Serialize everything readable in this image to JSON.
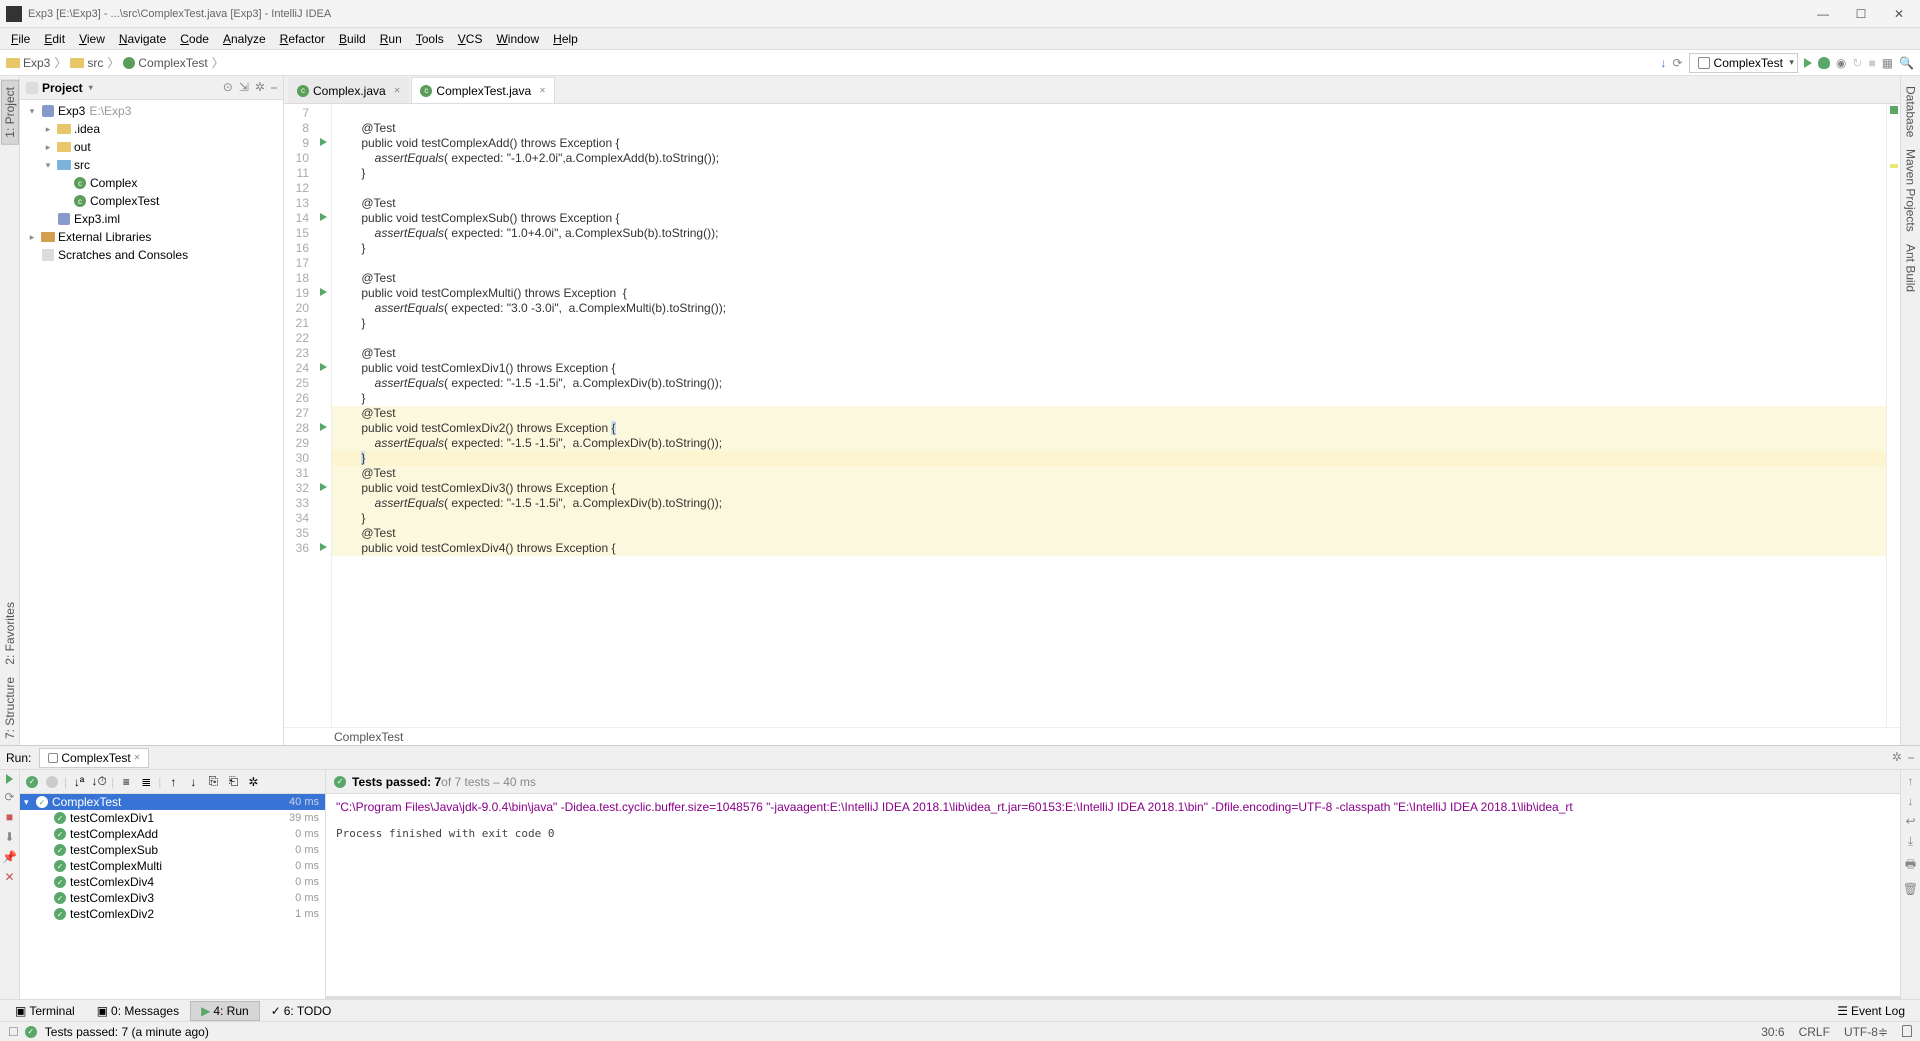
{
  "title": "Exp3 [E:\\Exp3] - ...\\src\\ComplexTest.java [Exp3] - IntelliJ IDEA",
  "menu": [
    "File",
    "Edit",
    "View",
    "Navigate",
    "Code",
    "Analyze",
    "Refactor",
    "Build",
    "Run",
    "Tools",
    "VCS",
    "Window",
    "Help"
  ],
  "breadcrumbs": [
    {
      "type": "folder",
      "label": "Exp3"
    },
    {
      "type": "folder",
      "label": "src"
    },
    {
      "type": "class",
      "label": "ComplexTest"
    }
  ],
  "run_config": "ComplexTest",
  "left_tabs": [
    "1: Project",
    "2: Favorites",
    "7: Structure"
  ],
  "right_tabs": [
    "Database",
    "Maven Projects",
    "Ant Build"
  ],
  "project_panel_title": "Project",
  "tree": [
    {
      "depth": 0,
      "tw": "▾",
      "icon": "mod",
      "label": "Exp3",
      "gray": "E:\\Exp3"
    },
    {
      "depth": 1,
      "tw": "▸",
      "icon": "folder",
      "label": ".idea"
    },
    {
      "depth": 1,
      "tw": "▸",
      "icon": "folder",
      "label": "out"
    },
    {
      "depth": 1,
      "tw": "▾",
      "icon": "folder-blue",
      "label": "src"
    },
    {
      "depth": 2,
      "tw": "",
      "icon": "class",
      "label": "Complex"
    },
    {
      "depth": 2,
      "tw": "",
      "icon": "class",
      "label": "ComplexTest"
    },
    {
      "depth": 1,
      "tw": "",
      "icon": "mod",
      "label": "Exp3.iml"
    },
    {
      "depth": 0,
      "tw": "▸",
      "icon": "lib",
      "label": "External Libraries"
    },
    {
      "depth": 0,
      "tw": "",
      "icon": "scratch",
      "label": "Scratches and Consoles"
    }
  ],
  "editor_tabs": [
    {
      "label": "Complex.java",
      "active": false
    },
    {
      "label": "ComplexTest.java",
      "active": true
    }
  ],
  "code_lines": [
    {
      "n": 7,
      "run": false,
      "txt": ""
    },
    {
      "n": 8,
      "run": false,
      "txt": "    <ann>@Test</ann>"
    },
    {
      "n": 9,
      "run": true,
      "txt": "    <kw>public void</kw> <meth>testComplexAdd</meth>() <kw>throws</kw> <exc>Exception</exc> {"
    },
    {
      "n": 10,
      "run": false,
      "txt": "        <i>assertEquals</i>( <hint>expected:</hint> <str>\"-1.0+2.0i\"</str>,a.ComplexAdd(b).toString());"
    },
    {
      "n": 11,
      "run": false,
      "txt": "    }"
    },
    {
      "n": 12,
      "run": false,
      "txt": ""
    },
    {
      "n": 13,
      "run": false,
      "txt": "    <ann>@Test</ann>"
    },
    {
      "n": 14,
      "run": true,
      "txt": "    <kw>public void</kw> <meth>testComplexSub</meth>() <kw>throws</kw> <exc>Exception</exc> {"
    },
    {
      "n": 15,
      "run": false,
      "txt": "        <i>assertEquals</i>( <hint>expected:</hint> <str>\"1.0+4.0i\"</str>, a.ComplexSub(b).toString());"
    },
    {
      "n": 16,
      "run": false,
      "txt": "    }"
    },
    {
      "n": 17,
      "run": false,
      "txt": ""
    },
    {
      "n": 18,
      "run": false,
      "txt": "    <ann>@Test</ann>"
    },
    {
      "n": 19,
      "run": true,
      "txt": "    <kw>public void</kw> <meth>testComplexMulti</meth>() <kw>throws</kw> <exc>Exception</exc>  {"
    },
    {
      "n": 20,
      "run": false,
      "txt": "        <i>assertEquals</i>( <hint>expected:</hint> <str>\"3.0 -3.0i\"</str>,  a.ComplexMulti(b).toString());"
    },
    {
      "n": 21,
      "run": false,
      "txt": "    }"
    },
    {
      "n": 22,
      "run": false,
      "txt": ""
    },
    {
      "n": 23,
      "run": false,
      "txt": "    <ann>@Test</ann>"
    },
    {
      "n": 24,
      "run": true,
      "txt": "    <kw>public void</kw> <meth>testComlexDiv1</meth>() <kw>throws</kw> <exc>Exception</exc> {"
    },
    {
      "n": 25,
      "run": false,
      "txt": "        <i>assertEquals</i>( <hint>expected:</hint> <str>\"-1.5 -1.5i\"</str>,  a.ComplexDiv(b).toString());"
    },
    {
      "n": 26,
      "run": false,
      "txt": "    }"
    },
    {
      "n": 27,
      "run": false,
      "txt": "    <ann>@Test</ann>",
      "hl": true
    },
    {
      "n": 28,
      "run": true,
      "txt": "    <kw>public void</kw> <meth>testComlexDiv2</meth>() <kw>throws</kw> <exc>Exception</exc> <span style='background:#cde'>{</span>",
      "hl": true
    },
    {
      "n": 29,
      "run": false,
      "txt": "        <i>assertEquals</i>( <hint>expected:</hint> <str>\"-1.5 -1.5i\"</str>,  a.ComplexDiv(b).toString());",
      "hl": true
    },
    {
      "n": 30,
      "run": false,
      "txt": "    <span style='background:#cde'>}</span>",
      "hlcur": true
    },
    {
      "n": 31,
      "run": false,
      "txt": "    <ann>@Test</ann>",
      "hl": true
    },
    {
      "n": 32,
      "run": true,
      "txt": "    <kw>public void</kw> <meth>testComlexDiv3</meth>() <kw>throws</kw> <exc>Exception</exc> {",
      "hl": true
    },
    {
      "n": 33,
      "run": false,
      "txt": "        <i>assertEquals</i>( <hint>expected:</hint> <str>\"-1.5 -1.5i\"</str>,  a.ComplexDiv(b).toString());",
      "hl": true
    },
    {
      "n": 34,
      "run": false,
      "txt": "    }",
      "hl": true
    },
    {
      "n": 35,
      "run": false,
      "txt": "    <ann>@Test</ann>",
      "hl": true
    },
    {
      "n": 36,
      "run": true,
      "txt": "    <kw>public void</kw> <meth>testComlexDiv4</meth>() <kw>throws</kw> <exc>Exception</exc> {",
      "hl": true
    }
  ],
  "code_crumb": "ComplexTest",
  "run": {
    "title": "Run:",
    "tab": "ComplexTest",
    "summary_bold": "Tests passed: 7",
    "summary_gray": " of 7 tests – 40 ms",
    "root": {
      "name": "ComplexTest",
      "time": "40 ms"
    },
    "tests": [
      {
        "name": "testComlexDiv1",
        "time": "39 ms"
      },
      {
        "name": "testComplexAdd",
        "time": "0 ms"
      },
      {
        "name": "testComplexSub",
        "time": "0 ms"
      },
      {
        "name": "testComplexMulti",
        "time": "0 ms"
      },
      {
        "name": "testComlexDiv4",
        "time": "0 ms"
      },
      {
        "name": "testComlexDiv3",
        "time": "0 ms"
      },
      {
        "name": "testComlexDiv2",
        "time": "1 ms"
      }
    ],
    "output_cmd": "\"C:\\Program Files\\Java\\jdk-9.0.4\\bin\\java\" -Didea.test.cyclic.buffer.size=1048576 \"-javaagent:E:\\IntelliJ IDEA 2018.1\\lib\\idea_rt.jar=60153:E:\\IntelliJ IDEA 2018.1\\bin\" -Dfile.encoding=UTF-8 -classpath \"E:\\IntelliJ IDEA 2018.1\\lib\\idea_rt",
    "output_exit": "Process finished with exit code 0"
  },
  "bottom_tabs": [
    {
      "label": "Terminal",
      "icon": "▣"
    },
    {
      "label": "0: Messages",
      "icon": "▣"
    },
    {
      "label": "4: Run",
      "icon": "▶",
      "active": true
    },
    {
      "label": "6: TODO",
      "icon": "✓"
    }
  ],
  "event_log": "Event Log",
  "status": {
    "msg": "Tests passed: 7 (a minute ago)",
    "caret": "30:6",
    "eol": "CRLF",
    "enc": "UTF-8"
  }
}
